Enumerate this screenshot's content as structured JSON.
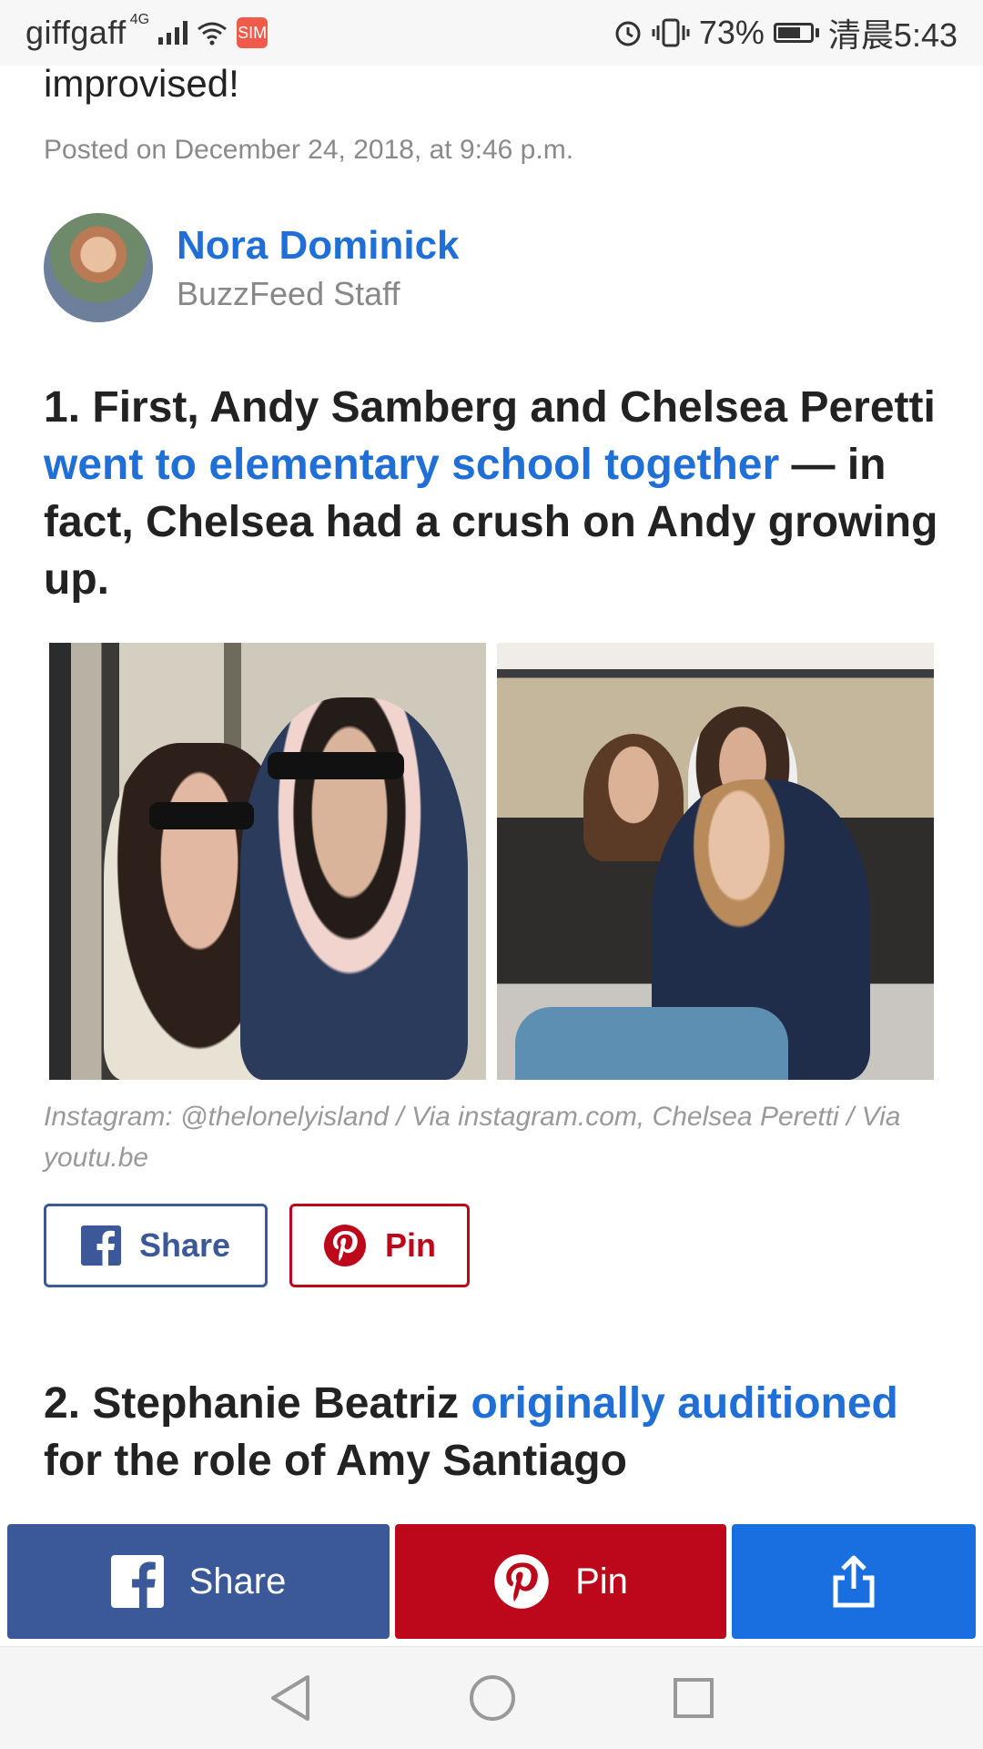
{
  "status_bar": {
    "carrier": "giffgaff",
    "network": "4G",
    "battery_percent": "73%",
    "battery_level": 0.73,
    "time": "清晨5:43",
    "app_badge": "SIM"
  },
  "article": {
    "prev_text_tail": "improvised!",
    "posted": "Posted on December 24, 2018, at 9:46 p.m.",
    "author": {
      "name": "Nora Dominick",
      "role": "BuzzFeed Staff"
    },
    "item1": {
      "text_a": "1. First, Andy Samberg and Chelsea Peretti ",
      "link": "went to elementary school together",
      "text_b": " — in fact, Chelsea had a crush on Andy growing up."
    },
    "image_credit": "Instagram: @thelonelyisland / Via instagram.com, Chelsea Peretti / Via youtu.be",
    "share_buttons": {
      "facebook_label": "Share",
      "pinterest_label": "Pin"
    },
    "item2": {
      "text_a": "2. Stephanie Beatriz ",
      "link": "originally auditioned",
      "text_b": " for the role of Amy Santiago"
    }
  },
  "sticky_share": {
    "facebook_label": "Share",
    "pinterest_label": "Pin"
  },
  "icons": [
    "facebook-icon",
    "pinterest-icon",
    "share-icon",
    "back-icon",
    "home-icon",
    "recents-icon",
    "alarm-icon",
    "wifi-icon",
    "vibrate-icon"
  ],
  "colors": {
    "link": "#1f6fd6",
    "facebook": "#3b5998",
    "pinterest": "#bd081c",
    "share": "#1a6fe0"
  }
}
